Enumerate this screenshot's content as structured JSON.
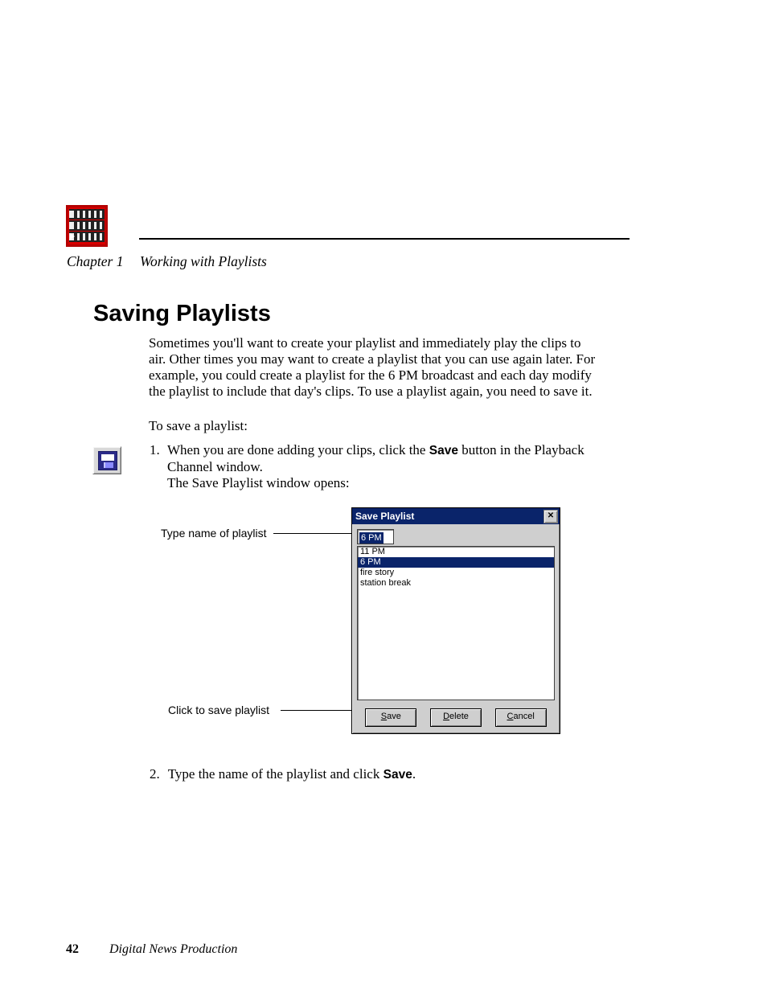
{
  "header": {
    "chapter_label": "Chapter 1",
    "chapter_title": "Working with Playlists"
  },
  "heading": "Saving Playlists",
  "intro": "Sometimes you'll want to create your playlist and immediately play the clips to air. Other times you may want to create a playlist that you can use again later. For example, you could create a playlist for the 6 PM broadcast and each day modify the playlist to include that day's clips. To use a playlist again, you need to save it.",
  "to_save": "To save a playlist:",
  "step1": {
    "num": "1.",
    "pre": "When you are done adding your clips, click the ",
    "bold": "Save",
    "post": " button in the Playback Channel window.",
    "line2": "The Save Playlist window opens:"
  },
  "callouts": {
    "name": "Type name of playlist",
    "save": "Click to save playlist"
  },
  "dialog": {
    "title": "Save Playlist",
    "close_glyph": "✕",
    "input_value": "6 PM",
    "items": [
      "11 PM",
      "6 PM",
      "fire story",
      "station break"
    ],
    "selected_index": 1,
    "buttons": {
      "save": {
        "accel": "S",
        "rest": "ave"
      },
      "delete": {
        "accel": "D",
        "rest": "elete"
      },
      "cancel": {
        "accel": "C",
        "rest": "ancel"
      }
    }
  },
  "step2": {
    "num": "2.",
    "pre": "Type the name of the playlist and click ",
    "bold": "Save",
    "post": "."
  },
  "footer": {
    "page": "42",
    "title": "Digital News Production"
  }
}
